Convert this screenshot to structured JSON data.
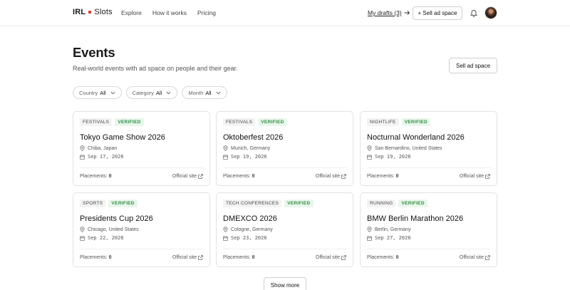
{
  "header": {
    "brand_left": "IRL",
    "brand_right": "Slots",
    "nav": [
      "Explore",
      "How it works",
      "Pricing"
    ],
    "drafts_label": "My drafts (3)",
    "sell_label": "+ Sell ad space"
  },
  "page": {
    "title": "Events",
    "subtitle": "Real-world events with ad space on people and their gear.",
    "sell_button": "Sell ad space",
    "show_more": "Show more"
  },
  "filters": [
    {
      "label": "Country",
      "value": "All"
    },
    {
      "label": "Category",
      "value": "All"
    },
    {
      "label": "Month",
      "value": "All"
    }
  ],
  "events": [
    {
      "category": "FESTIVALS",
      "verified": "VERIFIED",
      "title": "Tokyo Game Show 2026",
      "location": "Chiba, Japan",
      "date": "Sep 17, 2026",
      "placements_label": "Placements:",
      "placements": "0",
      "site": "Official site"
    },
    {
      "category": "FESTIVALS",
      "verified": "VERIFIED",
      "title": "Oktoberfest 2026",
      "location": "Munich, Germany",
      "date": "Sep 19, 2026",
      "placements_label": "Placements:",
      "placements": "0",
      "site": "Official site"
    },
    {
      "category": "NIGHTLIFE",
      "verified": "VERIFIED",
      "title": "Nocturnal Wonderland 2026",
      "location": "San Bernardino, United States",
      "date": "Sep 19, 2026",
      "placements_label": "Placements:",
      "placements": "0",
      "site": "Official site"
    },
    {
      "category": "SPORTS",
      "verified": "VERIFIED",
      "title": "Presidents Cup 2026",
      "location": "Chicago, United States",
      "date": "Sep 22, 2026",
      "placements_label": "Placements:",
      "placements": "0",
      "site": "Official site"
    },
    {
      "category": "TECH CONFERENCES",
      "verified": "VERIFIED",
      "title": "DMEXCO 2026",
      "location": "Cologne, Germany",
      "date": "Sep 23, 2026",
      "placements_label": "Placements:",
      "placements": "0",
      "site": "Official site"
    },
    {
      "category": "RUNNING",
      "verified": "VERIFIED",
      "title": "BMW Berlin Marathon 2026",
      "location": "Berlin, Germany",
      "date": "Sep 27, 2026",
      "placements_label": "Placements:",
      "placements": "0",
      "site": "Official site"
    }
  ],
  "colors": {
    "accent_dot": "#e0352b",
    "verified_text": "#2f8f46",
    "verified_bg": "#e9f6ec"
  },
  "icons": {
    "bell": "bell-icon",
    "arrow": "arrow-right-icon",
    "pin": "map-pin-icon",
    "calendar": "calendar-icon",
    "external": "external-link-icon",
    "chevron": "chevron-down-icon"
  }
}
